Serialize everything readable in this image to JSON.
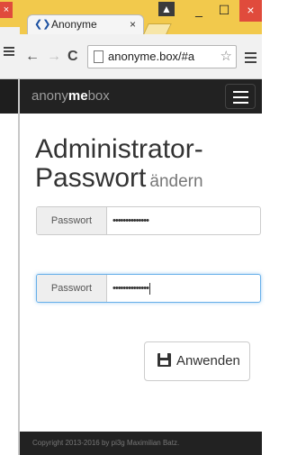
{
  "browser": {
    "tab_title": "Anonyme",
    "tab_close": "×",
    "window_controls": {
      "user": "▲",
      "minimize": "_",
      "maximize": "☐",
      "close": "×"
    },
    "back": "←",
    "forward": "→",
    "reload": "C",
    "address": "anonyme.box/#a",
    "star": "☆"
  },
  "background_window": {
    "close": "×"
  },
  "site": {
    "brand_prefix": "anony",
    "brand_bold": "me",
    "brand_suffix": "box",
    "title": "Administrator-Passwort",
    "subtitle": "ändern",
    "fields": [
      {
        "label": "Passwort",
        "value": "••••••••••••••"
      },
      {
        "label": "Passwort",
        "value": "••••••••••••••"
      }
    ],
    "apply_label": "Anwenden",
    "footer": "Copyright 2013-2016 by pi3g Maximilian Batz."
  }
}
